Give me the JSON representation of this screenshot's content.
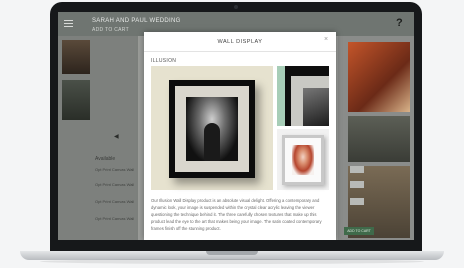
{
  "app": {
    "title": "SARAH AND PAUL WEDDING",
    "subtitle": "ADD TO CART",
    "help_label": "?",
    "section_label": "Available",
    "products": [
      "Opt Print Canvas Wall",
      "Opt Print Canvas Wall",
      "Opt Print Canvas Wall",
      "Opt Print Canvas Wall"
    ],
    "add_to_cart_label": "ADD TO CART",
    "nav_prev": "◀",
    "nav_next": "▶"
  },
  "modal": {
    "title": "WALL DISPLAY",
    "close_label": "×",
    "option_label": "ILLUSION",
    "description": "Our Illusion Wall Display product is an absolute visual delight. Offering a contemporary and dynamic look, your image is suspended within the crystal clear acrylic leaving the viewer questioning the technique behind it. The three carefully chosen textures that make up this product lead the eye to the art that makes being your image. The satin coated contemporary frames finish off the stunning product."
  },
  "colors": {
    "modal_background": "#ffffff",
    "detail_mat_green": "#a7cdb7",
    "add_to_cart_green": "#3f6a4a",
    "laptop_bezel": "#16181a"
  }
}
